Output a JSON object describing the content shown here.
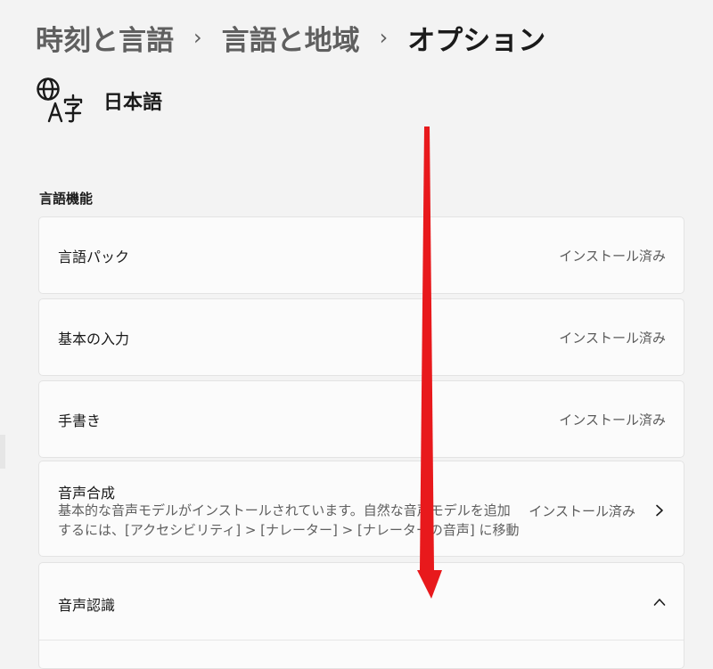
{
  "breadcrumb": {
    "items": [
      "時刻と言語",
      "言語と地域",
      "オプション"
    ],
    "separator": "›"
  },
  "language": {
    "icon": "language-icon",
    "name": "日本語"
  },
  "section": {
    "title": "言語機能"
  },
  "features": [
    {
      "title": "言語パック",
      "status": "インストール済み"
    },
    {
      "title": "基本の入力",
      "status": "インストール済み"
    },
    {
      "title": "手書き",
      "status": "インストール済み"
    },
    {
      "title": "音声合成",
      "description": "基本的な音声モデルがインストールされています。自然な音声モデルを追加するには、[アクセシビリティ] > [ナレーター] > [ナレーターの音声] に移動",
      "status": "インストール済み",
      "icon": "chevron-right-icon"
    },
    {
      "title": "音声認識",
      "icon": "chevron-up-icon",
      "expanded": true
    }
  ],
  "annotation": {
    "type": "arrow",
    "color": "#e8191c",
    "direction": "down"
  }
}
